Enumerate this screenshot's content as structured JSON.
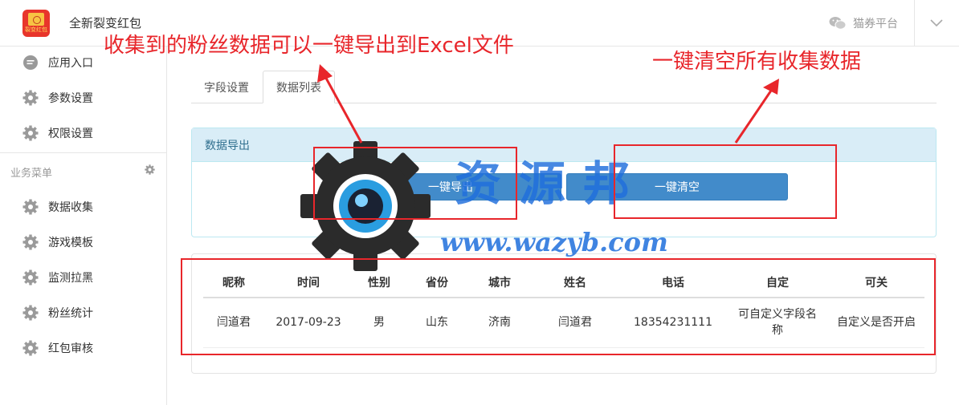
{
  "header": {
    "logo_text": "裂变红包",
    "app_title": "全新裂变红包",
    "platform_label": "猫券平台"
  },
  "sidebar": {
    "items_top": [
      {
        "label": "应用入口",
        "icon": "chat-bubble-icon"
      },
      {
        "label": "参数设置",
        "icon": "gear-icon"
      },
      {
        "label": "权限设置",
        "icon": "gear-icon"
      }
    ],
    "section_title": "业务菜单",
    "items_business": [
      {
        "label": "数据收集",
        "icon": "gear-icon"
      },
      {
        "label": "游戏模板",
        "icon": "gear-icon"
      },
      {
        "label": "监测拉黑",
        "icon": "gear-icon"
      },
      {
        "label": "粉丝统计",
        "icon": "gear-icon"
      },
      {
        "label": "红包审核",
        "icon": "gear-icon"
      }
    ]
  },
  "tabs": [
    {
      "label": "字段设置",
      "active": false
    },
    {
      "label": "数据列表",
      "active": true
    }
  ],
  "export_panel": {
    "title": "数据导出",
    "export_button": "一键导出",
    "clear_button": "一键清空"
  },
  "table": {
    "headers": [
      "昵称",
      "时间",
      "性别",
      "省份",
      "城市",
      "姓名",
      "电话",
      "自定",
      "可关"
    ],
    "rows": [
      [
        "闫道君",
        "2017-09-23",
        "男",
        "山东",
        "济南",
        "闫道君",
        "18354231111",
        "可自定义字段名称",
        "自定义是否开启"
      ]
    ]
  },
  "annotations": {
    "left": "收集到的粉丝数据可以一键导出到Excel文件",
    "right": "一键清空所有收集数据",
    "color": "#e8262b"
  },
  "watermark": {
    "chinese": "资源邦",
    "url": "www.wazyb.com"
  },
  "colors": {
    "primary_button": "#428bca",
    "panel_header_bg": "#d9edf7",
    "panel_header_text": "#31708f"
  }
}
